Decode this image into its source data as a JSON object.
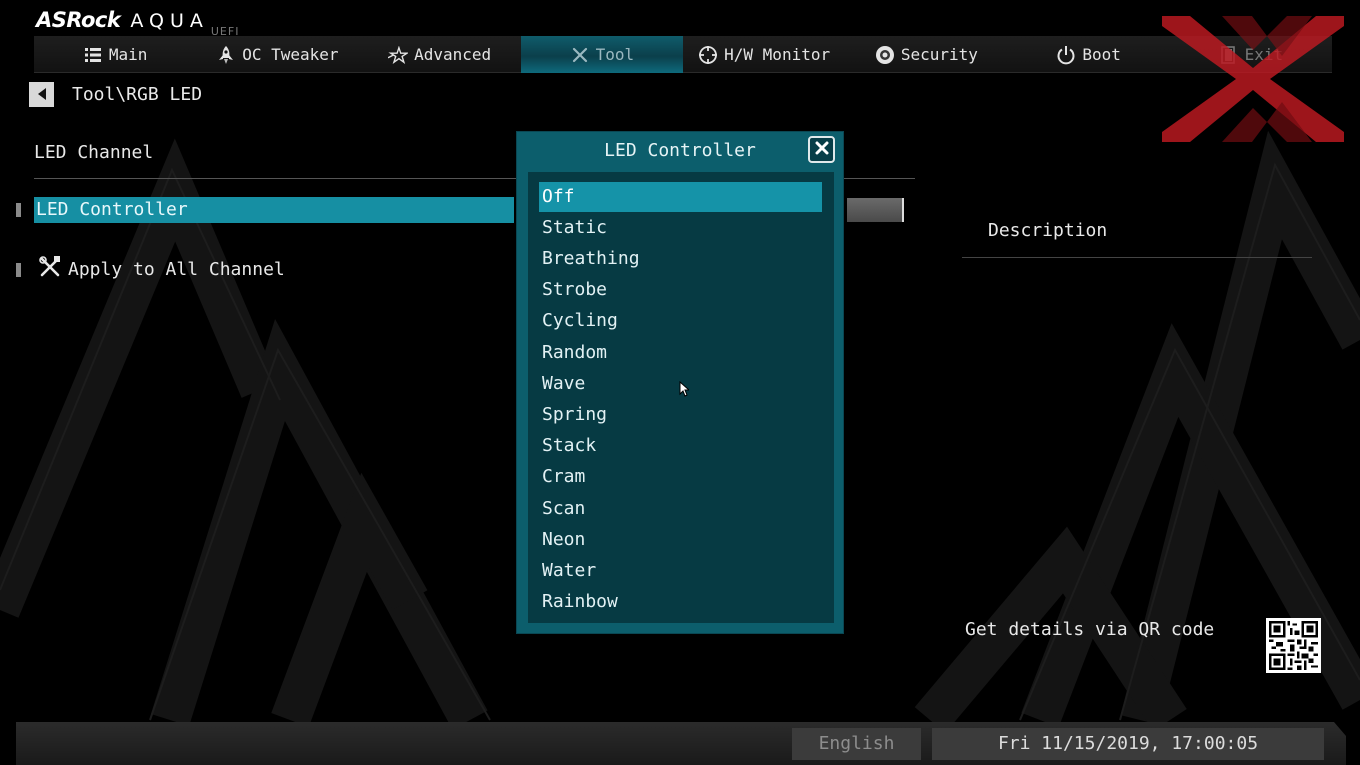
{
  "brand": {
    "name": "ASRock",
    "product": "AQUA",
    "sub": "UEFI"
  },
  "nav": {
    "tabs": [
      {
        "label": "Main",
        "icon": "list-icon",
        "active": false
      },
      {
        "label": "OC Tweaker",
        "icon": "rocket-icon",
        "active": false
      },
      {
        "label": "Advanced",
        "icon": "star-icon",
        "active": false
      },
      {
        "label": "Tool",
        "icon": "tools-icon",
        "active": true
      },
      {
        "label": "H/W Monitor",
        "icon": "crosshair-icon",
        "active": false
      },
      {
        "label": "Security",
        "icon": "shield-icon",
        "active": false
      },
      {
        "label": "Boot",
        "icon": "power-icon",
        "active": false
      },
      {
        "label": "Exit",
        "icon": "exit-door-icon",
        "active": false
      }
    ]
  },
  "breadcrumb": {
    "path": "Tool\\RGB LED"
  },
  "section": {
    "title": "LED Channel",
    "items": [
      {
        "label": "LED Controller",
        "selected": true
      },
      {
        "label": "Apply to All Channel",
        "icon": "tools-icon",
        "selected": false
      }
    ]
  },
  "description": {
    "title": "Description",
    "qr_text": "Get details via QR code"
  },
  "popup": {
    "title": "LED Controller",
    "options": [
      "Off",
      "Static",
      "Breathing",
      "Strobe",
      "Cycling",
      "Random",
      "Wave",
      "Spring",
      "Stack",
      "Cram",
      "Scan",
      "Neon",
      "Water",
      "Rainbow"
    ],
    "selected": "Off"
  },
  "footer": {
    "language": "English",
    "datetime": "Fri 11/15/2019, 17:00:05"
  },
  "colors": {
    "accent": "#168fa3",
    "popup_bg": "#0c5e6c",
    "list_bg": "#063a43",
    "watermark": "#c01a22"
  }
}
